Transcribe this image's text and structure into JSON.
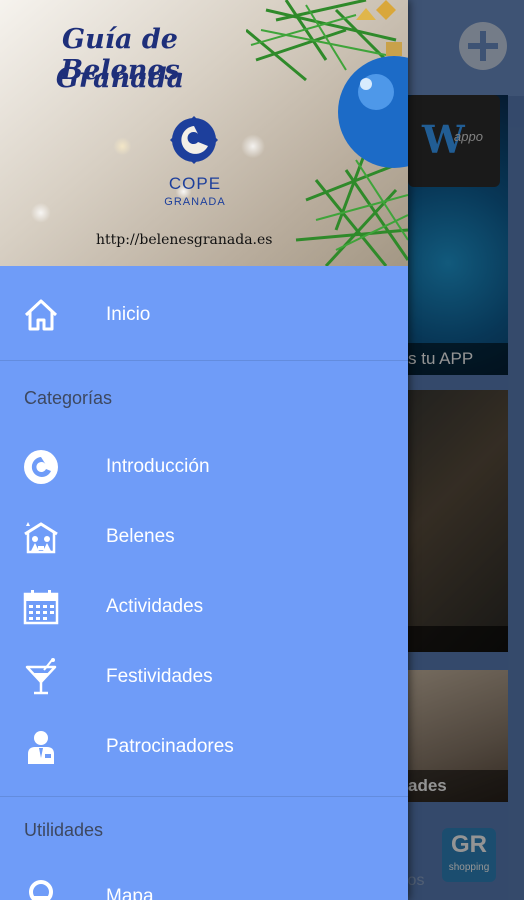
{
  "header": {
    "title_line1": "Guía de Belenes",
    "title_line2": "Granada",
    "logo_text": "COPE",
    "logo_subtext": "GRANADA",
    "url": "http://belenesgranada.es"
  },
  "menu": {
    "home": {
      "label": "Inicio",
      "icon": "home-icon"
    },
    "categories_title": "Categorías",
    "categories": [
      {
        "label": "Introducción",
        "icon": "cope-icon"
      },
      {
        "label": "Belenes",
        "icon": "nativity-icon"
      },
      {
        "label": "Actividades",
        "icon": "calendar-icon"
      },
      {
        "label": "Festividades",
        "icon": "cocktail-icon"
      },
      {
        "label": "Patrocinadores",
        "icon": "sponsor-icon"
      }
    ],
    "utilities_title": "Utilidades",
    "utilities": [
      {
        "label": "Mapa",
        "icon": "map-pin-icon"
      }
    ]
  },
  "background": {
    "card1_caption": "s tu APP",
    "card3_caption": "ades",
    "badge_top": "GR",
    "badge_bottom": "shopping",
    "bottom_text": "ios"
  },
  "colors": {
    "drawer": "#6f9cf8",
    "title": "#1e2f7a",
    "menu_text": "#ffffff",
    "section_text": "#3d4860"
  }
}
